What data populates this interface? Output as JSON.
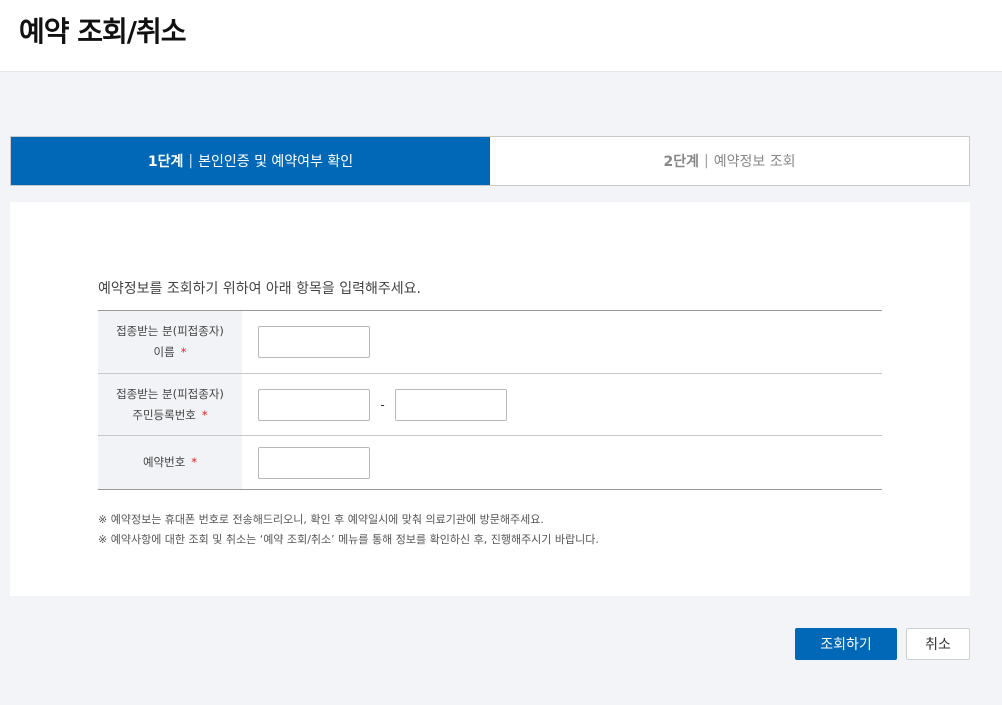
{
  "header": {
    "title": "예약 조회/취소"
  },
  "steps": [
    {
      "num": "1단계",
      "sep": "|",
      "label": "본인인증 및 예약여부 확인"
    },
    {
      "num": "2단계",
      "sep": "|",
      "label": "예약정보 조회"
    }
  ],
  "form": {
    "intro": "예약정보를 조회하기 위하여 아래 항목을 입력해주세요.",
    "name_label_line1": "접종받는 분(피접종자)",
    "name_label_line2": "이름",
    "rrn_label_line1": "접종받는 분(피접종자)",
    "rrn_label_line2": "주민등록번호",
    "rrn_dash": "-",
    "reservation_label": "예약번호",
    "required_mark": "*",
    "name_value": "",
    "rrn_front_value": "",
    "rrn_back_value": "",
    "reservation_value": ""
  },
  "notes": [
    "※ 예약정보는 휴대폰 번호로 전송해드리오니, 확인 후 예약일시에 맞춰 의료기관에 방문해주세요.",
    "※ 예약사항에 대한 조회 및 취소는 ‘예약 조회/취소’ 메뉴를 통해 정보를 확인하신 후, 진행해주시기 바랍니다."
  ],
  "buttons": {
    "search": "조회하기",
    "cancel": "취소"
  }
}
